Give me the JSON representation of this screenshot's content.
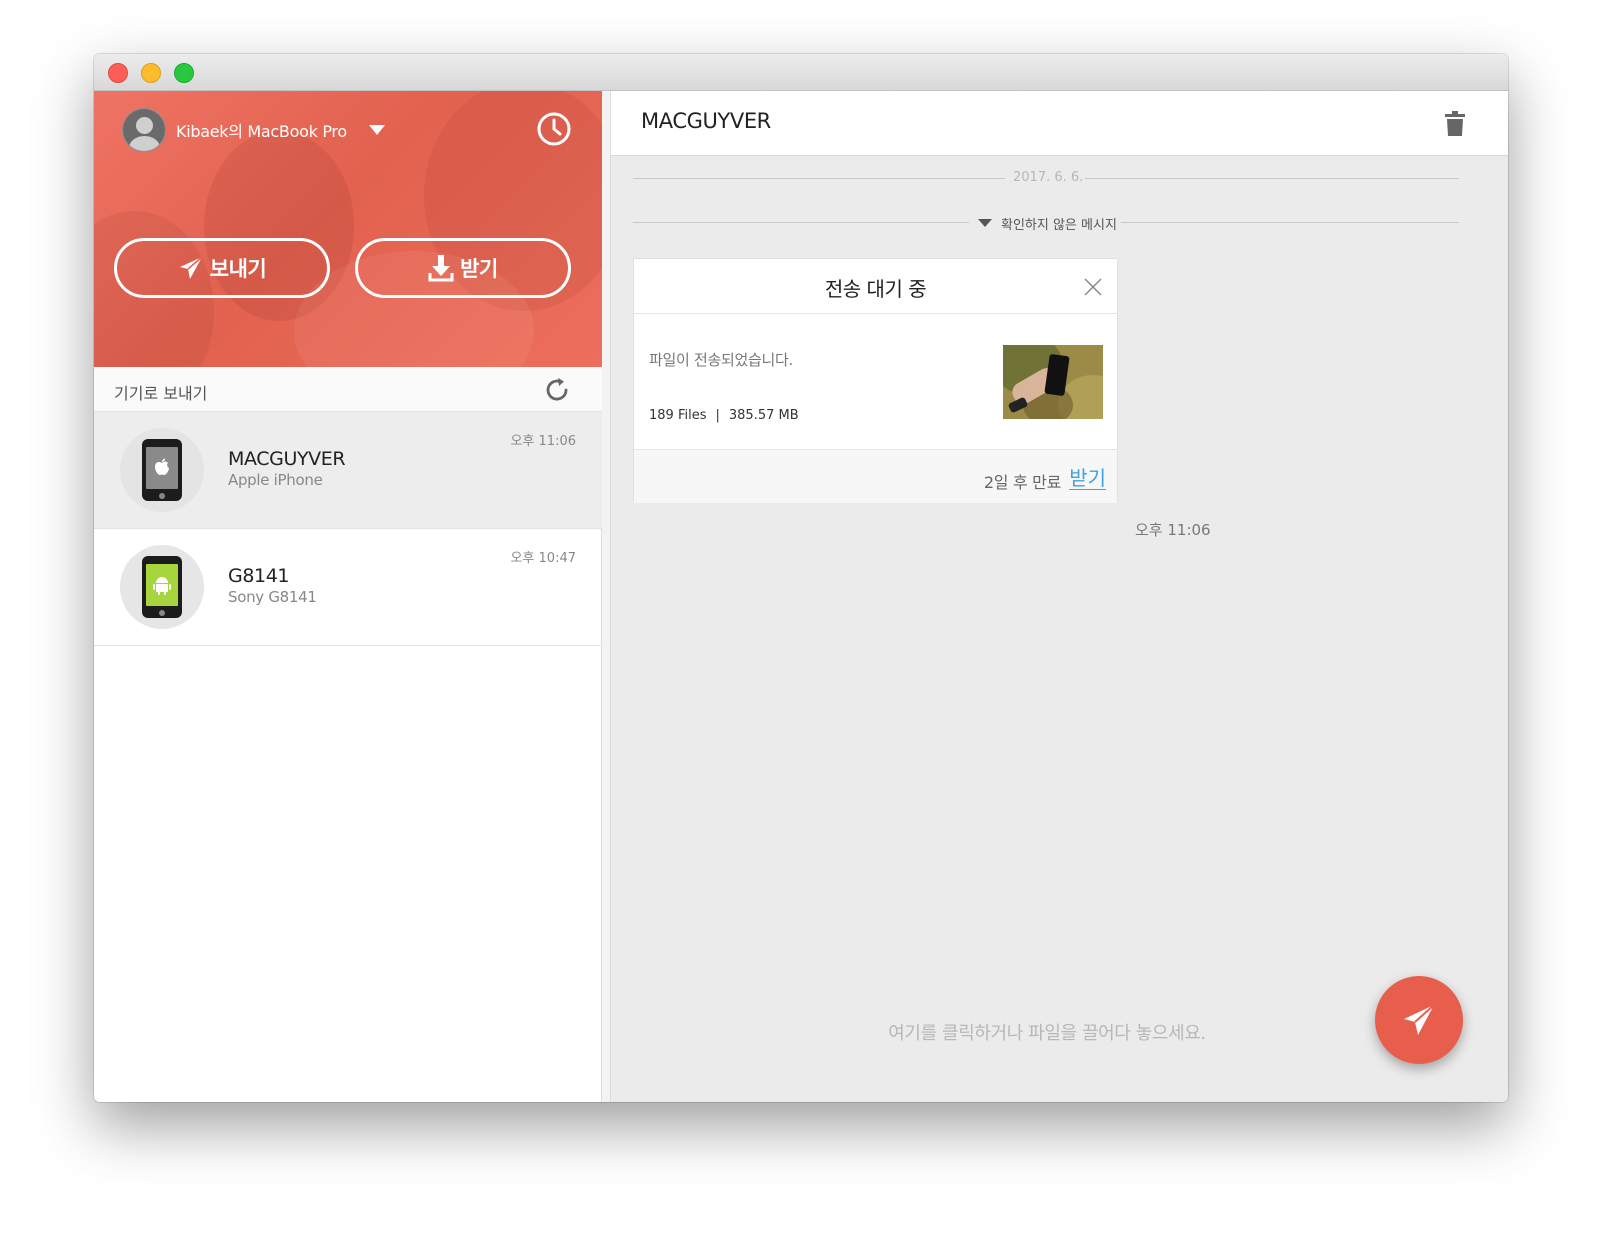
{
  "window": {
    "traffic_lights": [
      "close",
      "minimize",
      "maximize"
    ]
  },
  "sidebar": {
    "account_name": "Kibaek의 MacBook Pro",
    "send_button_label": "보내기",
    "receive_button_label": "받기",
    "section_title": "기기로 보내기",
    "accent_color": "#e8604e",
    "devices": [
      {
        "name": "MACGUYVER",
        "model": "Apple iPhone",
        "time": "오후 11:06",
        "icon": "apple-phone-icon",
        "selected": true
      },
      {
        "name": "G8141",
        "model": "Sony G8141",
        "time": "오후 10:47",
        "icon": "android-phone-icon",
        "selected": false
      }
    ]
  },
  "main": {
    "title": "MACGUYVER",
    "date_separator": "2017. 6. 6.",
    "unread_separator": "확인하지 않은 메시지",
    "card": {
      "title": "전송 대기 중",
      "message": "파일이 전송되었습니다.",
      "files_count": "189 Files",
      "size": "385.57 MB",
      "expire_text": "2일 후 만료",
      "receive_label": "받기",
      "time": "오후 11:06"
    },
    "drop_hint": "여기를 클릭하거나 파일을 끌어다 놓으세요.",
    "link_color": "#3ba4e0"
  }
}
